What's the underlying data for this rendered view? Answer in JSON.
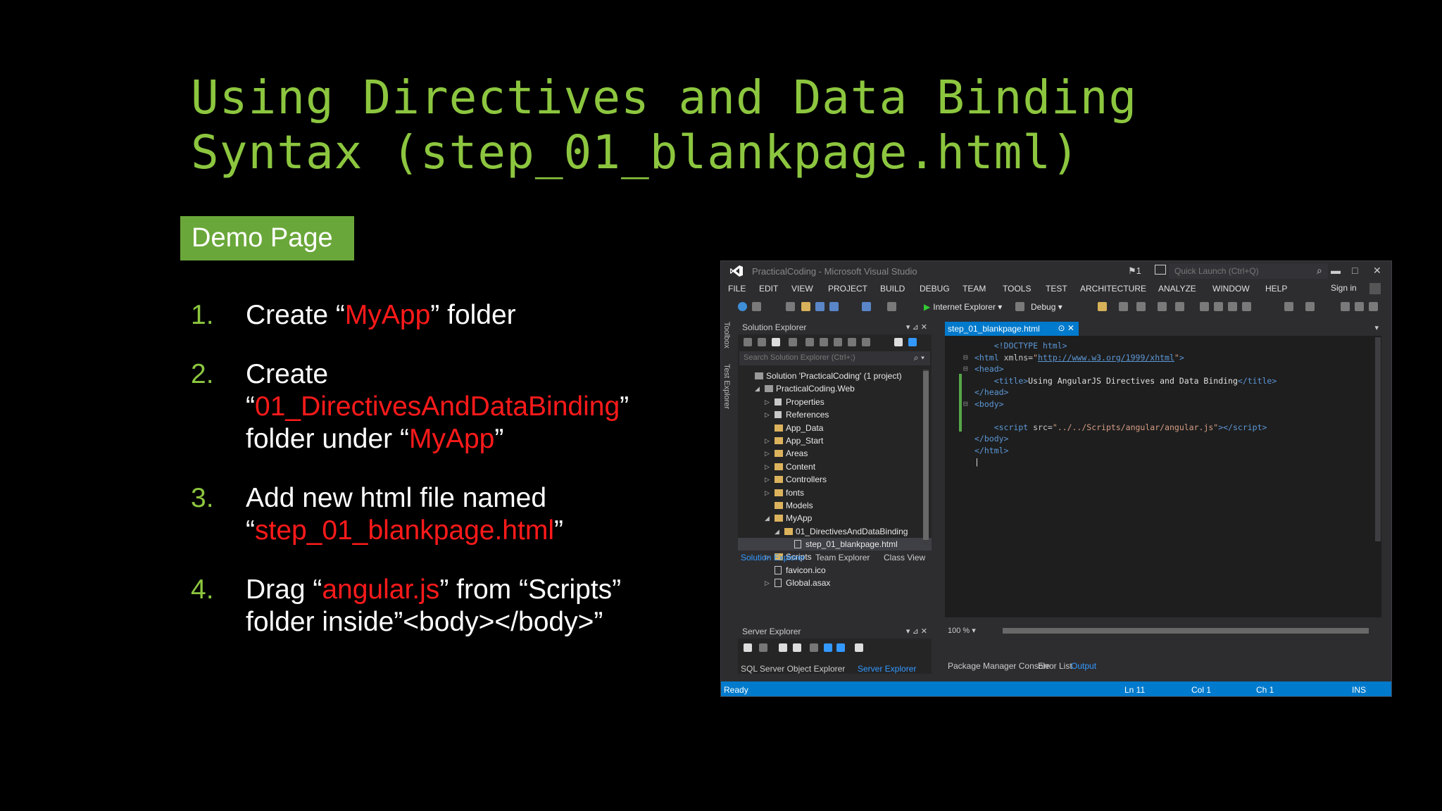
{
  "slide": {
    "title_line1": "Using Directives and Data Binding",
    "title_line2": "Syntax (step_01_blankpage.html)",
    "demo_badge": "Demo Page",
    "accent_color": "#8cc63f",
    "highlight_color": "#ff1a1a",
    "steps": [
      {
        "num": "1.",
        "parts": [
          "Create “",
          "MyApp",
          "” folder"
        ]
      },
      {
        "num": "2.",
        "parts": [
          "Create",
          "“",
          "01_DirectivesAndDataBinding",
          "”",
          "folder under “",
          "MyApp",
          "”"
        ]
      },
      {
        "num": "3.",
        "parts": [
          "Add new html file named",
          "“",
          "step_01_blankpage.html",
          "”"
        ]
      },
      {
        "num": "4.",
        "parts": [
          "Drag “",
          "angular.js",
          "” from “Scripts”",
          "folder inside”<body></body>”"
        ]
      }
    ]
  },
  "vs": {
    "window_title": "PracticalCoding - Microsoft Visual Studio",
    "flag_count": "1",
    "quick_launch": "Quick Launch (Ctrl+Q)",
    "menu": [
      "FILE",
      "EDIT",
      "VIEW",
      "PROJECT",
      "BUILD",
      "DEBUG",
      "TEAM",
      "TOOLS",
      "TEST",
      "ARCHITECTURE",
      "ANALYZE",
      "WINDOW",
      "HELP"
    ],
    "sign_in": "Sign in",
    "run_target": "Internet Explorer",
    "config": "Debug",
    "side_toolbox": "Toolbox",
    "side_test": "Test Explorer",
    "solution_explorer": {
      "title": "Solution Explorer",
      "search_placeholder": "Search Solution Explorer (Ctrl+;)",
      "tree": [
        {
          "label": "Solution 'PracticalCoding' (1 project)",
          "indent": 0,
          "arrow": "",
          "icon": "sol"
        },
        {
          "label": "PracticalCoding.Web",
          "indent": 1,
          "arrow": "◢",
          "icon": "proj"
        },
        {
          "label": "Properties",
          "indent": 2,
          "arrow": "▷",
          "icon": "wrench"
        },
        {
          "label": "References",
          "indent": 2,
          "arrow": "▷",
          "icon": "ref"
        },
        {
          "label": "App_Data",
          "indent": 2,
          "arrow": "",
          "icon": "folder"
        },
        {
          "label": "App_Start",
          "indent": 2,
          "arrow": "▷",
          "icon": "folder"
        },
        {
          "label": "Areas",
          "indent": 2,
          "arrow": "▷",
          "icon": "folder"
        },
        {
          "label": "Content",
          "indent": 2,
          "arrow": "▷",
          "icon": "folder"
        },
        {
          "label": "Controllers",
          "indent": 2,
          "arrow": "▷",
          "icon": "folder"
        },
        {
          "label": "fonts",
          "indent": 2,
          "arrow": "▷",
          "icon": "folder"
        },
        {
          "label": "Models",
          "indent": 2,
          "arrow": "",
          "icon": "folder"
        },
        {
          "label": "MyApp",
          "indent": 2,
          "arrow": "◢",
          "icon": "folder"
        },
        {
          "label": "01_DirectivesAndDataBinding",
          "indent": 3,
          "arrow": "◢",
          "icon": "folder"
        },
        {
          "label": "step_01_blankpage.html",
          "indent": 4,
          "arrow": "",
          "icon": "file",
          "selected": true
        },
        {
          "label": "Scripts",
          "indent": 2,
          "arrow": "▷",
          "icon": "folder"
        },
        {
          "label": "favicon.ico",
          "indent": 2,
          "arrow": "",
          "icon": "file"
        },
        {
          "label": "Global.asax",
          "indent": 2,
          "arrow": "▷",
          "icon": "file"
        }
      ],
      "tabs": [
        "Solution Explorer",
        "Team Explorer",
        "Class View"
      ]
    },
    "server_explorer": {
      "title": "Server Explorer",
      "tabs": [
        "SQL Server Object Explorer",
        "Server Explorer"
      ]
    },
    "editor": {
      "tab_label": "step_01_blankpage.html",
      "zoom": "100 %"
    },
    "bottom_tabs": [
      "Package Manager Console",
      "Error List",
      "Output"
    ],
    "status": {
      "state": "Ready",
      "line": "Ln 11",
      "col": "Col 1",
      "ch": "Ch 1",
      "mode": "INS"
    }
  }
}
